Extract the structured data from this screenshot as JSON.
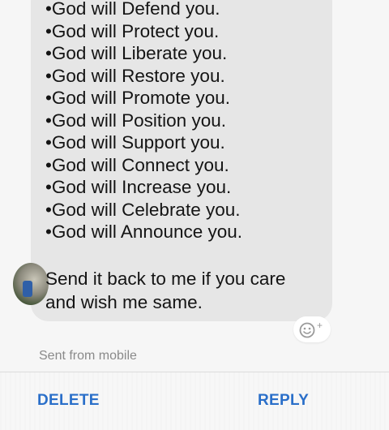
{
  "message": {
    "lines": [
      "•God will Defend you.",
      "•God will Protect you.",
      "•God will Liberate you.",
      "•God will Restore you.",
      "•God will Promote you.",
      "•God will Position you.",
      "•God will Support you.",
      "•God will Connect you.",
      "•God will Increase you.",
      "•God will Celebrate you.",
      "•God will Announce you."
    ],
    "closing": [
      "Send it back to me if you care",
      "and wish me same."
    ]
  },
  "reaction": {
    "icon": "add-reaction-icon",
    "plus": "+"
  },
  "status": {
    "sent_from": "Sent from mobile"
  },
  "actions": {
    "delete_label": "DELETE",
    "reply_label": "REPLY"
  },
  "colors": {
    "accent": "#2a6fc9",
    "bubble": "#e6e6e6",
    "text": "#141414",
    "muted": "#8a8a8a"
  }
}
